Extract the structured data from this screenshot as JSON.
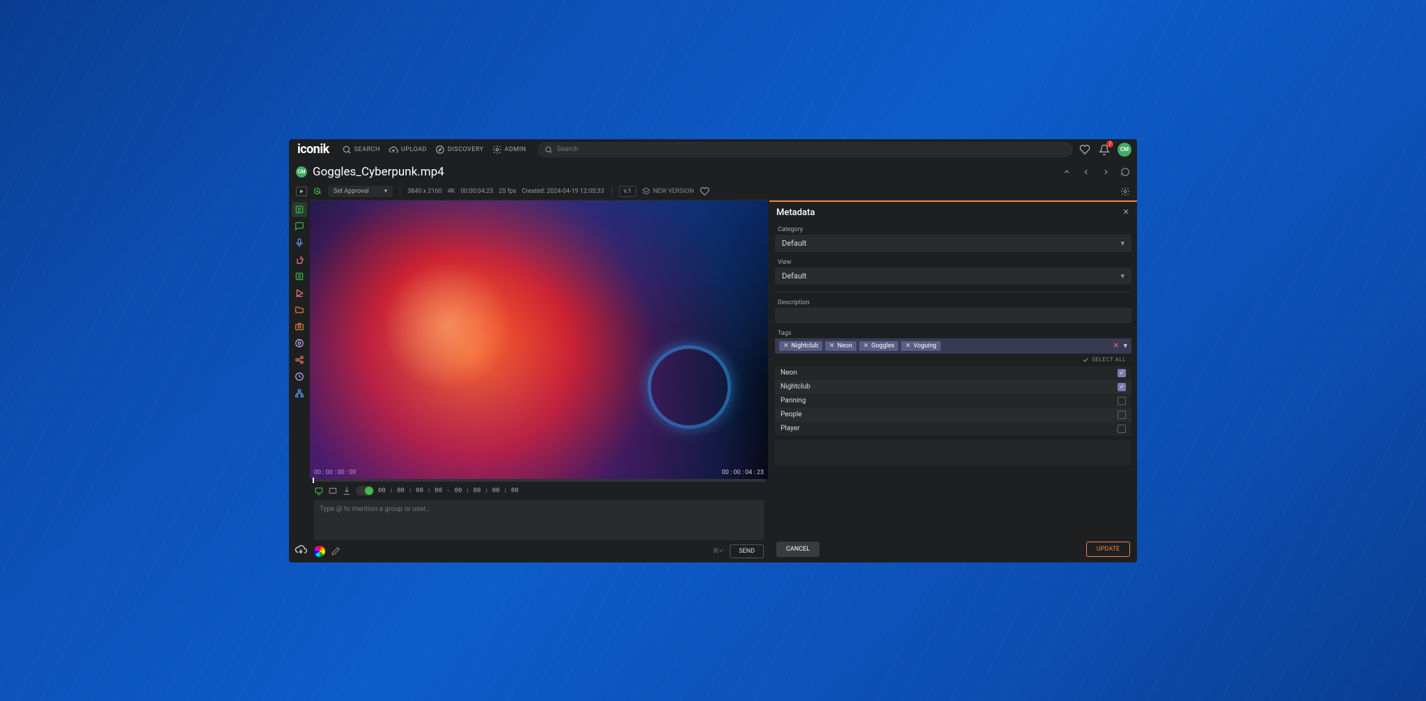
{
  "brand": "iconik",
  "nav": {
    "search": "SEARCH",
    "upload": "UPLOAD",
    "discovery": "DISCOVERY",
    "admin": "ADMIN"
  },
  "search": {
    "placeholder": "Search"
  },
  "notifications": {
    "count": "7"
  },
  "user": {
    "initials": "CM"
  },
  "asset": {
    "title": "Goggles_Cyberpunk.mp4",
    "owner_initials": "CM",
    "approval_label": "Set Approval",
    "resolution": "3840 x 2160",
    "quality": "4K",
    "duration": "00:00:04:23",
    "fps": "25 fps",
    "created": "Created: 2024-04-19 12:05:33",
    "version": "v.1",
    "new_version": "NEW VERSION"
  },
  "player": {
    "pos_tc": "00 : 00 : 00 : 00",
    "dur_tc": "00 : 00 : 04 : 23",
    "range_in": "00 : 00 : 00 : 00",
    "range_out": "00 : 00 : 00 : 00"
  },
  "comment": {
    "placeholder": "Type @ to mention a group or user…",
    "shortcut": "⌘↵",
    "send": "SEND"
  },
  "metadata": {
    "panel_title": "Metadata",
    "category_label": "Category",
    "category_value": "Default",
    "view_label": "View",
    "view_value": "Default",
    "description_label": "Description",
    "tags_label": "Tags",
    "selected_tags": [
      {
        "label": "Nightclub"
      },
      {
        "label": "Neon"
      },
      {
        "label": "Goggles"
      },
      {
        "label": "Voguing"
      }
    ],
    "select_all": "SELECT ALL",
    "tag_options": [
      {
        "label": "Neon",
        "checked": true
      },
      {
        "label": "Nightclub",
        "checked": true
      },
      {
        "label": "Panning",
        "checked": false
      },
      {
        "label": "People",
        "checked": false
      },
      {
        "label": "Player",
        "checked": false
      }
    ],
    "cancel": "CANCEL",
    "update": "UPDATE"
  }
}
